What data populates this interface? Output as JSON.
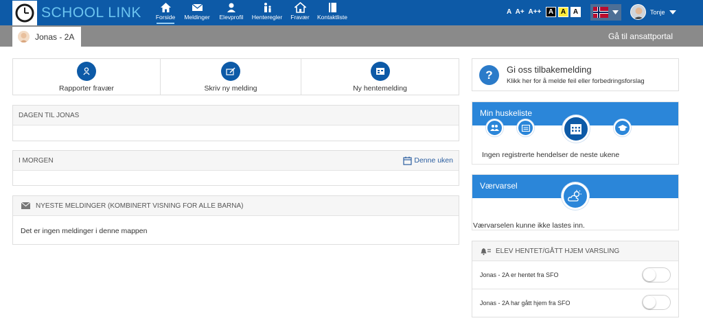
{
  "app": {
    "brand": "SCHOOL LINK"
  },
  "nav": [
    {
      "label": "Forside",
      "icon": "home-icon",
      "active": true
    },
    {
      "label": "Meldinger",
      "icon": "envelope-icon"
    },
    {
      "label": "Elevprofil",
      "icon": "student-profile-icon"
    },
    {
      "label": "Henteregler",
      "icon": "pickup-rules-icon"
    },
    {
      "label": "Fravær",
      "icon": "house-absence-icon"
    },
    {
      "label": "Kontaktliste",
      "icon": "contact-book-icon"
    }
  ],
  "font_size": {
    "a": "A",
    "a_plus": "A+",
    "a_plus_plus": "A++"
  },
  "contrast": [
    "A",
    "A",
    "A"
  ],
  "user": {
    "name": "Tonje"
  },
  "child_tab": {
    "label": "Jonas - 2A"
  },
  "staff_portal": "Gå til ansattportal",
  "actions": [
    {
      "label": "Rapporter fravær",
      "icon": "report-absence-icon"
    },
    {
      "label": "Skriv ny melding",
      "icon": "write-message-icon"
    },
    {
      "label": "Ny hentemelding",
      "icon": "pickup-message-icon"
    }
  ],
  "today": {
    "title": "DAGEN TIL JONAS"
  },
  "tomorrow": {
    "title": "I MORGEN",
    "week_link": "Denne uken"
  },
  "messages": {
    "title": "NYESTE MELDINGER (KOMBINERT VISNING FOR ALLE BARNA)",
    "empty": "Det er ingen meldinger i denne mappen"
  },
  "feedback": {
    "title": "Gi oss tilbakemelding",
    "subtitle": "Klikk her for å melde feil eller forbedringsforslag"
  },
  "todo": {
    "title": "Min huskeliste",
    "empty": "Ingen registrerte hendelser de neste ukene"
  },
  "weather": {
    "title": "Værvarsel",
    "error": "Værvarselen kunne ikke lastes inn."
  },
  "pickup_notify": {
    "title": "ELEV HENTET/GÅTT HJEM VARSLING",
    "rows": [
      {
        "label": "Jonas - 2A er hentet fra SFO",
        "on": false
      },
      {
        "label": "Jonas - 2A har gått hjem fra SFO",
        "on": false
      }
    ]
  },
  "colors": {
    "header": "#0d5aa7",
    "accent": "#2b86d9",
    "subbar": "#8a8a8a"
  }
}
